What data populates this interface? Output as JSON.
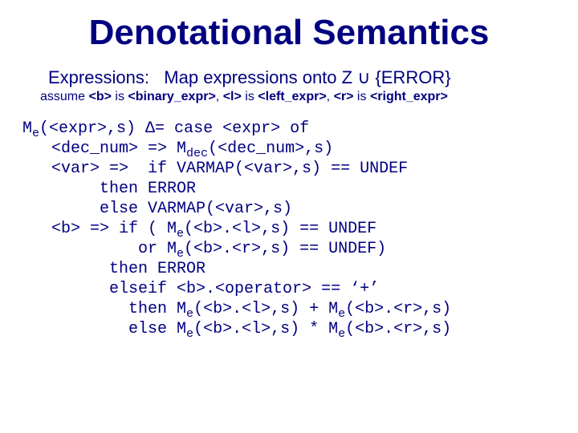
{
  "title": "Denotational Semantics",
  "subline": {
    "label": "Expressions:",
    "text": "Map expressions onto Z ∪ {ERROR}"
  },
  "assume": {
    "prefix": "assume ",
    "b": "<b>",
    "is1": " is ",
    "binexpr": "<binary_expr>",
    "comma1": ", ",
    "l": "<l>",
    "is2": " is ",
    "lexpr": "<left_expr>",
    "comma2": ", ",
    "r": "<r>",
    "is3": " is ",
    "rexpr": "<right_expr>"
  },
  "body": {
    "l1a": "M",
    "l1b": "(<expr>,s) Δ= case <expr> of",
    "l2a": "   <dec_num> => M",
    "l2b": "(<dec_num>,s)",
    "l3": "   <var> =>  if VARMAP(<var>,s) == UNDEF",
    "l4": "        then ERROR",
    "l5": "        else VARMAP(<var>,s)",
    "l6a": "   <b> => if ( M",
    "l6b": "(<b>.<l>,s) == UNDEF",
    "l7a": "            or M",
    "l7b": "(<b>.<r>,s) == UNDEF)",
    "l8": "         then ERROR",
    "l9": "         elseif <b>.<operator> == ‘+’",
    "l10a": "           then M",
    "l10b": "(<b>.<l>,s) + M",
    "l10c": "(<b>.<r>,s)",
    "l11a": "           else M",
    "l11b": "(<b>.<l>,s) * M",
    "l11c": "(<b>.<r>,s)",
    "sub_e": "e",
    "sub_dec": "dec"
  }
}
